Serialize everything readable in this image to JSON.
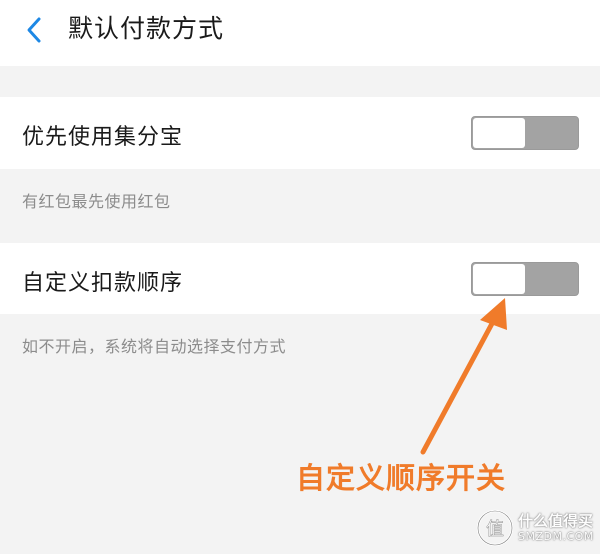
{
  "header": {
    "title": "默认付款方式"
  },
  "settings": {
    "prefer_fund": {
      "label": "优先使用集分宝",
      "enabled": false,
      "hint": "有红包最先使用红包"
    },
    "custom_order": {
      "label": "自定义扣款顺序",
      "enabled": false,
      "hint": "如不开启，系统将自动选择支付方式"
    }
  },
  "annotation": {
    "text": "自定义顺序开关",
    "color": "#f07b2a"
  },
  "watermark": {
    "logo_char": "值",
    "cn": "什么值得买",
    "en": "SMZDM.COM"
  },
  "colors": {
    "accent": "#1e88e5",
    "toggle_off": "#a3a3a3",
    "annotation": "#f07b2a"
  },
  "icons": {
    "back": "chevron-left-icon"
  }
}
